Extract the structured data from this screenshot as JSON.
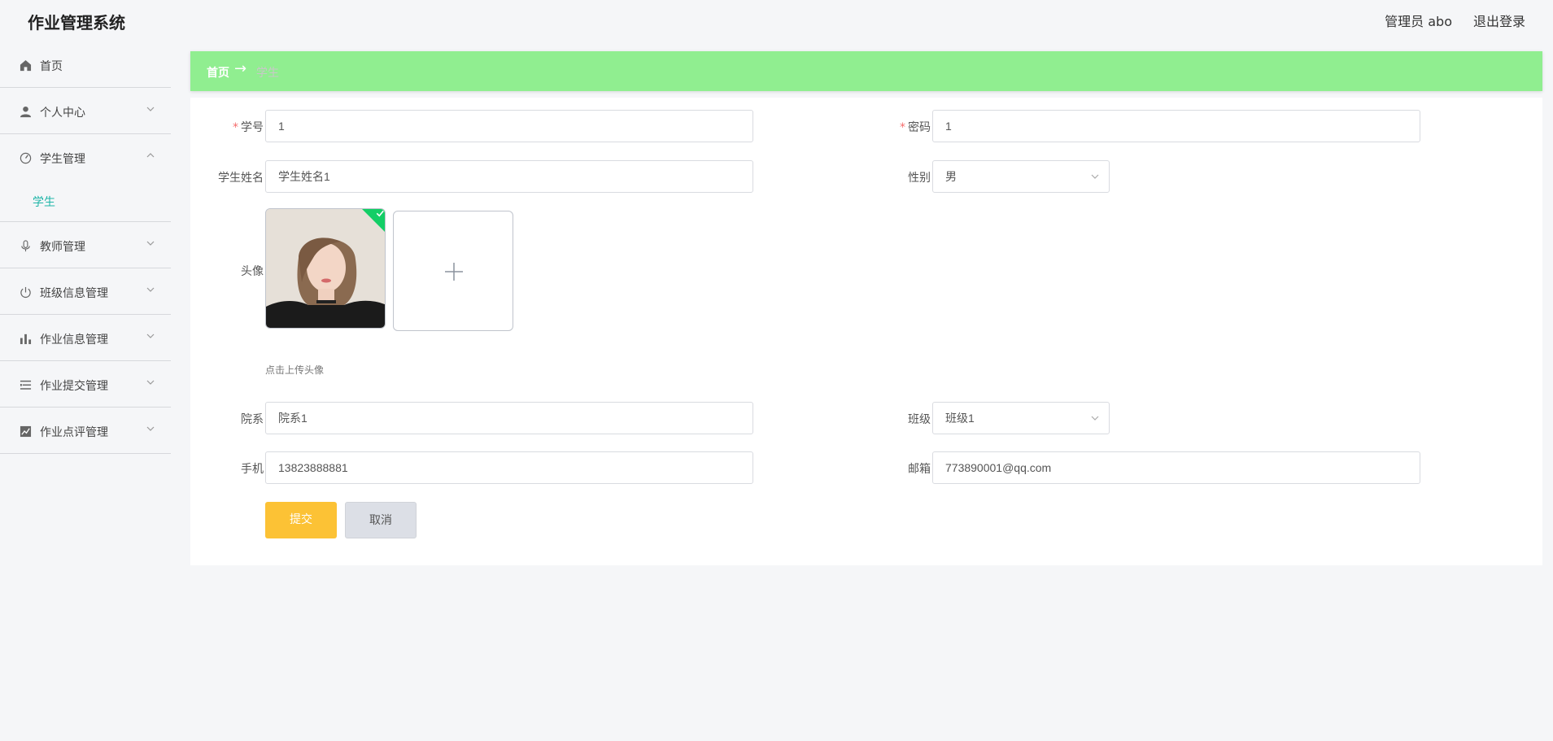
{
  "header": {
    "title": "作业管理系统",
    "user": "管理员 abo",
    "logout": "退出登录"
  },
  "sidebar": {
    "items": [
      {
        "label": "首页",
        "icon": "home-icon"
      },
      {
        "label": "个人中心",
        "icon": "user-icon"
      },
      {
        "label": "学生管理",
        "icon": "dashboard-icon",
        "expanded": true
      },
      {
        "label": "教师管理",
        "icon": "microphone-icon"
      },
      {
        "label": "班级信息管理",
        "icon": "power-icon"
      },
      {
        "label": "作业信息管理",
        "icon": "bar-chart-icon"
      },
      {
        "label": "作业提交管理",
        "icon": "list-icon"
      },
      {
        "label": "作业点评管理",
        "icon": "line-chart-icon"
      }
    ],
    "sub_item": "学生",
    "active_color": "#1fb5a8"
  },
  "breadcrumb": {
    "home": "首页",
    "separator": "→",
    "current": "学生",
    "bg_color": "#90ee90"
  },
  "form": {
    "student_id": {
      "label": "学号",
      "value": "1",
      "required": true
    },
    "password": {
      "label": "密码",
      "value": "1",
      "required": true
    },
    "name": {
      "label": "学生姓名",
      "value": "学生姓名1"
    },
    "gender": {
      "label": "性别",
      "value": "男"
    },
    "avatar": {
      "label": "头像",
      "tip": "点击上传头像"
    },
    "department": {
      "label": "院系",
      "value": "院系1"
    },
    "class": {
      "label": "班级",
      "value": "班级1"
    },
    "phone": {
      "label": "手机",
      "value": "13823888881"
    },
    "email": {
      "label": "邮箱",
      "value": "773890001@qq.com"
    },
    "submit": "提交",
    "cancel": "取消",
    "submit_color": "#fcc235"
  }
}
